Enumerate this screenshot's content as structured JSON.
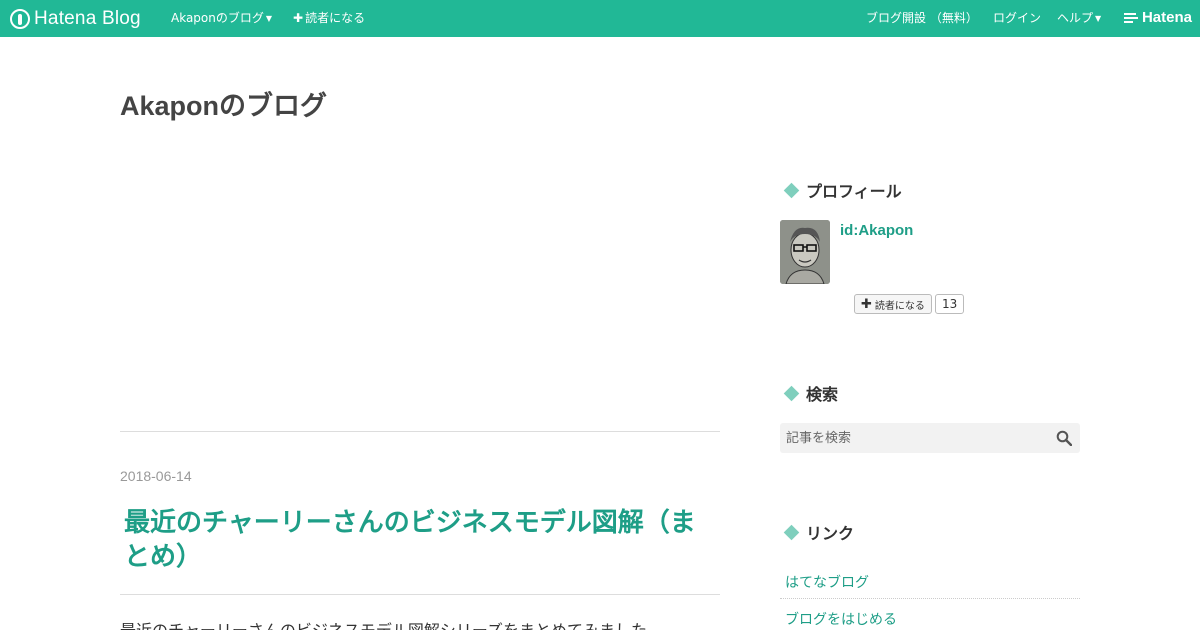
{
  "topbar": {
    "logo_text": "Hatena Blog",
    "blog_menu": "Akaponのブログ",
    "subscribe": "読者になる",
    "open_blog": "ブログ開設 （無料）",
    "login": "ログイン",
    "help": "ヘルプ",
    "brand": "Hatena"
  },
  "blog": {
    "title": "Akaponのブログ"
  },
  "entry": {
    "date": "2018-06-14",
    "title": "最近のチャーリーさんのビジネスモデル図解（まとめ）",
    "body_first_line": "最近のチャーリーさんのビジネスモデル図解シリーズをまとめてみました"
  },
  "sidebar": {
    "profile": {
      "heading": "プロフィール",
      "user_id": "id:Akapon",
      "subscribe_label": "読者になる",
      "subscriber_count": "13"
    },
    "search": {
      "heading": "検索",
      "placeholder": "記事を検索"
    },
    "links": {
      "heading": "リンク",
      "items": [
        {
          "label": "はてなブログ"
        },
        {
          "label": "ブログをはじめる"
        }
      ]
    }
  },
  "colors": {
    "topbar_bg": "#21b896",
    "link": "#1e9e87",
    "diamond": "#7fcfbd"
  },
  "icons": {
    "search": "search-icon",
    "plus": "plus-icon",
    "caret": "caret-down-icon"
  }
}
